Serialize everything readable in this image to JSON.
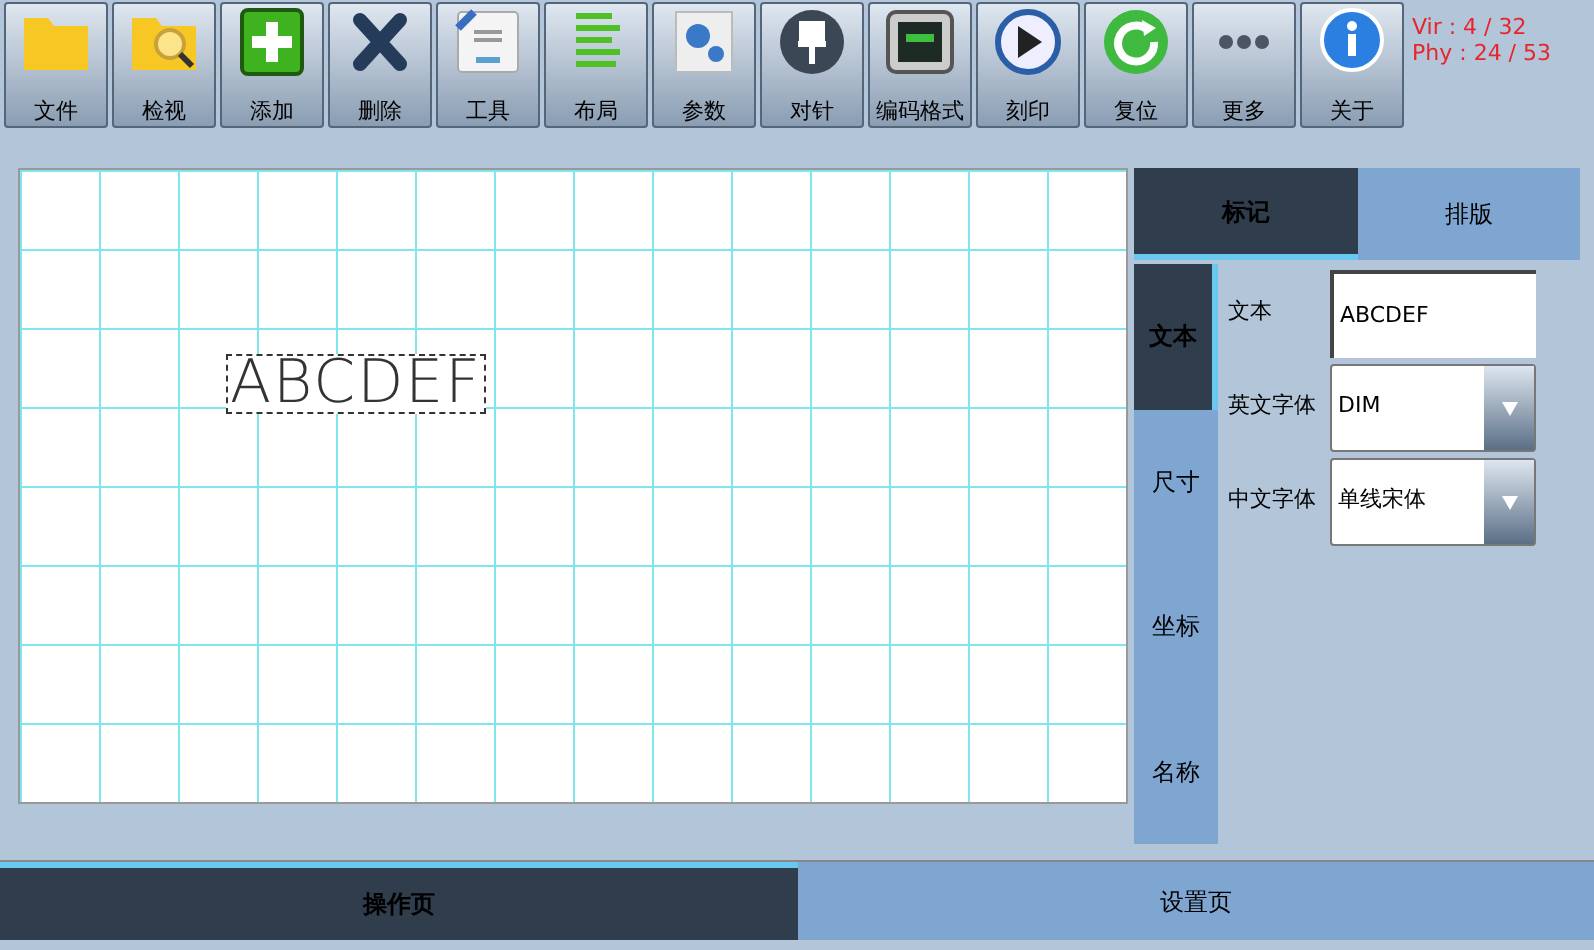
{
  "toolbar": [
    {
      "label": "文件",
      "kind": "folder"
    },
    {
      "label": "检视",
      "kind": "inspect"
    },
    {
      "label": "添加",
      "kind": "add"
    },
    {
      "label": "删除",
      "kind": "delete"
    },
    {
      "label": "工具",
      "kind": "tool"
    },
    {
      "label": "布局",
      "kind": "layout"
    },
    {
      "label": "参数",
      "kind": "gears"
    },
    {
      "label": "对针",
      "kind": "pin"
    },
    {
      "label": "编码格式",
      "kind": "code"
    },
    {
      "label": "刻印",
      "kind": "play"
    },
    {
      "label": "复位",
      "kind": "reset"
    },
    {
      "label": "更多",
      "kind": "more"
    },
    {
      "label": "关于",
      "kind": "info"
    }
  ],
  "status": [
    "Vir : 4 / 32",
    "Phy : 24 / 53"
  ],
  "canvas": {
    "text": "ABCDEF"
  },
  "panel_tabs": [
    {
      "label": "标记",
      "selected": true
    },
    {
      "label": "排版",
      "selected": false
    }
  ],
  "side_tabs": [
    {
      "label": "文本",
      "selected": true
    },
    {
      "label": "尺寸",
      "selected": false
    },
    {
      "label": "坐标",
      "selected": false
    },
    {
      "label": "名称",
      "selected": false
    }
  ],
  "fields": [
    {
      "label": "文本",
      "kind": "text",
      "value": "ABCDEF"
    },
    {
      "label": "英文字体",
      "kind": "select",
      "value": "DIM"
    },
    {
      "label": "中文字体",
      "kind": "select",
      "value": "单线宋体"
    }
  ],
  "bottom_tabs": [
    {
      "label": "操作页",
      "selected": true
    },
    {
      "label": "设置页",
      "selected": false
    }
  ]
}
